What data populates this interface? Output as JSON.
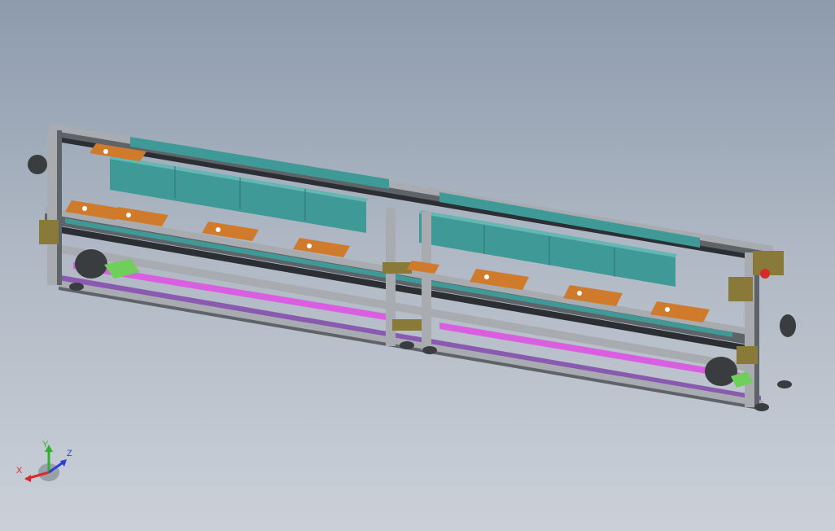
{
  "viewport": {
    "background_top": "#8d9bad",
    "background_bottom": "#cbd0d8"
  },
  "model": {
    "description_icon": "conveyor-assembly-icon",
    "colors": {
      "frame": "#a8acb1",
      "frame_dark": "#5e6368",
      "belt": "#2b2f33",
      "cover": "#3f9a97",
      "cover_dark": "#2c7472",
      "fixture": "#d07a2c",
      "fixture_dark": "#8c4e17",
      "accent_magenta": "#d95fe0",
      "accent_purple": "#8a5ab0",
      "accent_green": "#6fcf5a",
      "motor": "#3a3d40",
      "bracket": "#8a7a3a"
    }
  },
  "triad": {
    "x_label": "X",
    "y_label": "Y",
    "z_label": "Z",
    "x_color": "#d62a2a",
    "y_color": "#2fb12f",
    "z_color": "#2a3fd6"
  }
}
